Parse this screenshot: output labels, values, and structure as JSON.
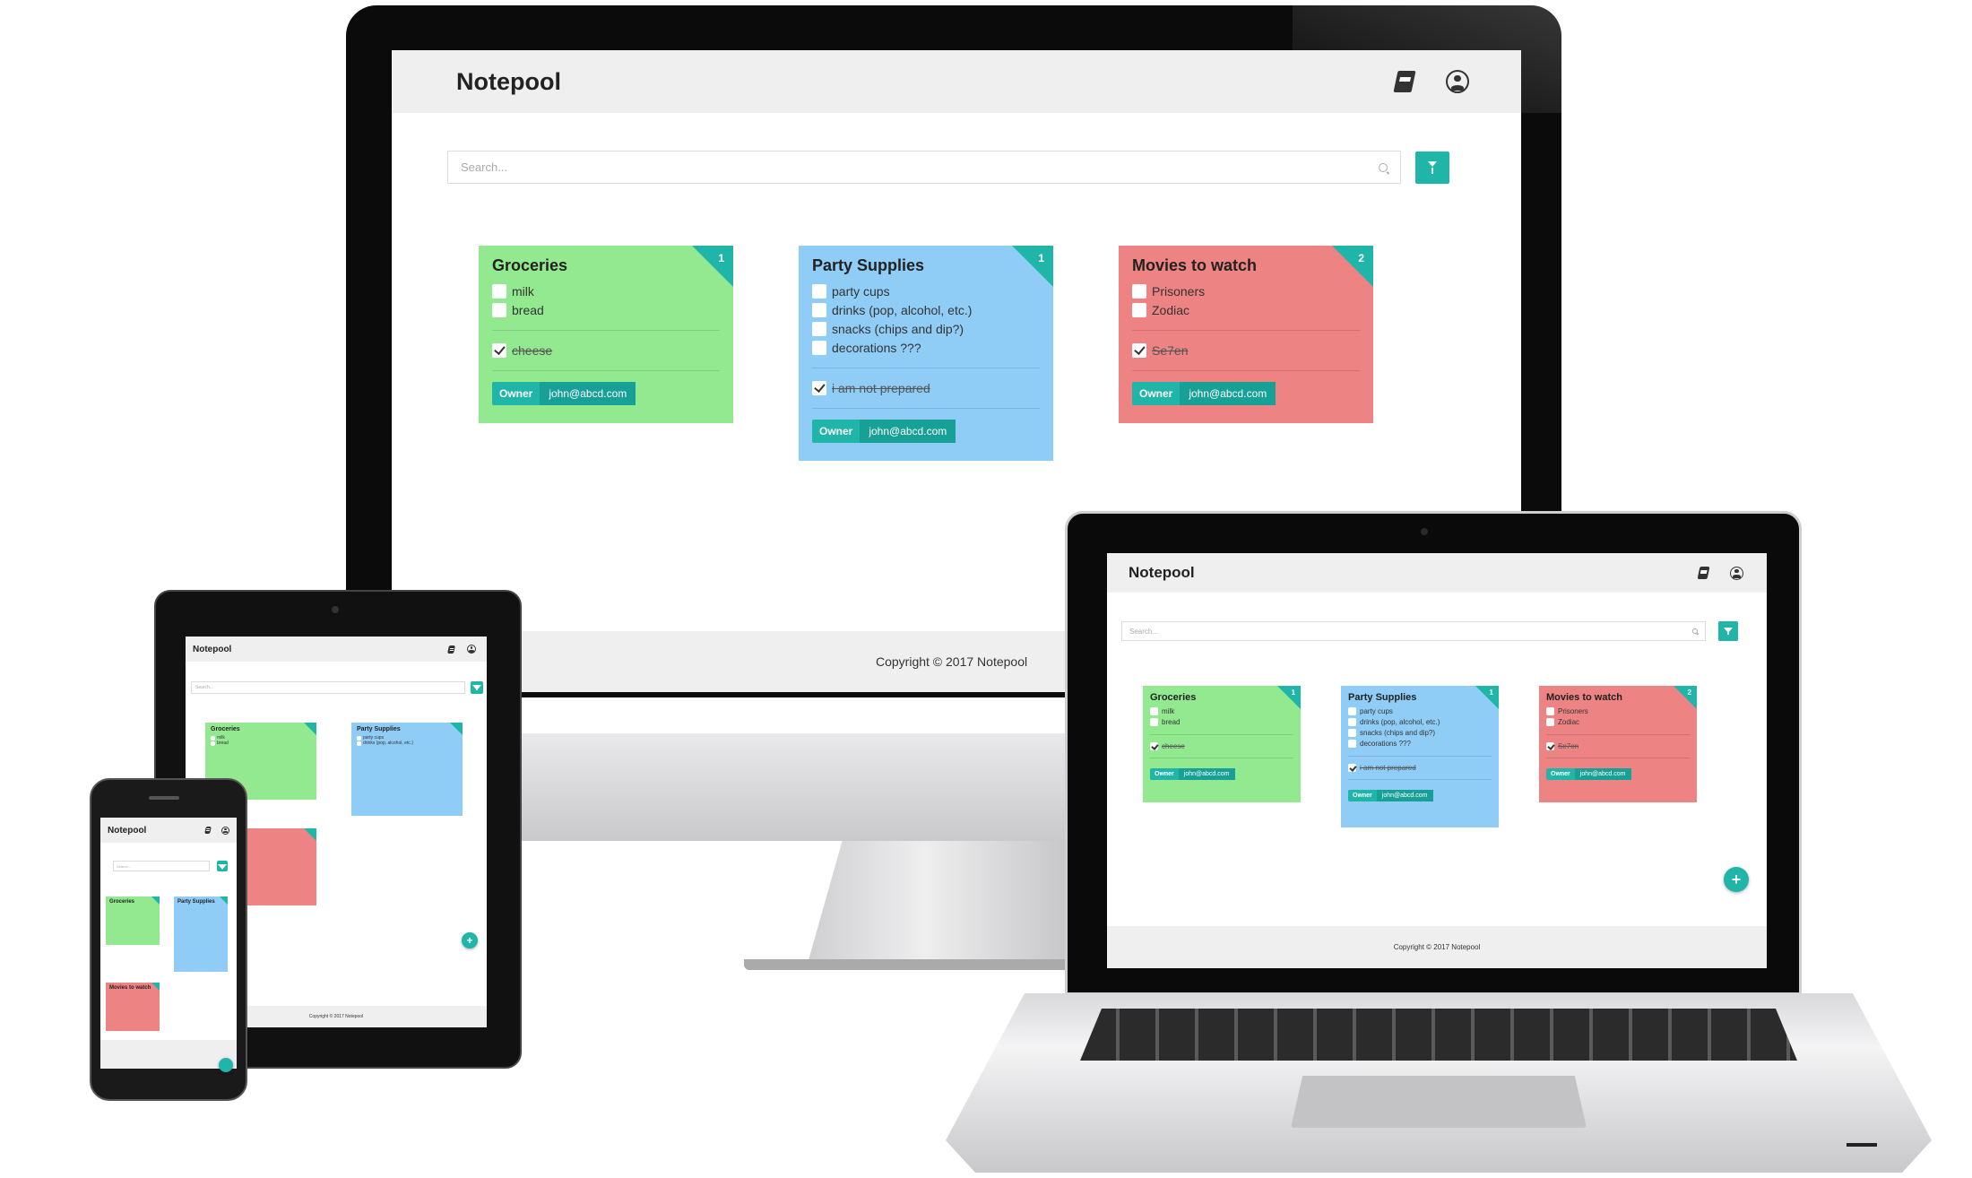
{
  "app": {
    "title": "Notepool",
    "header_icons": [
      "book-icon",
      "user-circle-icon"
    ],
    "search_placeholder": "Search...",
    "filter_icon": "filter-icon",
    "fab_label": "+",
    "footer": "Copyright © 2017 Notepool",
    "accent_color": "#1fb5a8"
  },
  "notes": [
    {
      "title": "Groceries",
      "color": "#92e98f",
      "count": "1",
      "unchecked": [
        "milk",
        "bread"
      ],
      "checked": [
        "cheese"
      ],
      "owner_label": "Owner",
      "owner": "john@abcd.com"
    },
    {
      "title": "Party Supplies",
      "color": "#8fcdf7",
      "count": "1",
      "unchecked": [
        "party cups",
        "drinks (pop, alcohol, etc.)",
        "snacks (chips and dip?)",
        "decorations ???"
      ],
      "checked": [
        "i am not prepared"
      ],
      "owner_label": "Owner",
      "owner": "john@abcd.com"
    },
    {
      "title": "Movies to watch",
      "color": "#ee8383",
      "count": "2",
      "unchecked": [
        "Prisoners",
        "Zodiac"
      ],
      "checked": [
        "Se7en"
      ],
      "owner_label": "Owner",
      "owner": "john@abcd.com"
    }
  ]
}
